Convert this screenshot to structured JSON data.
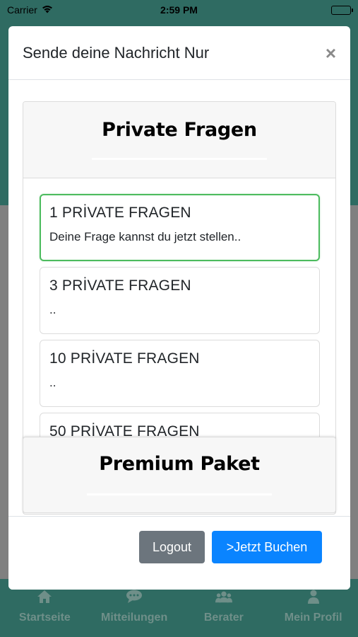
{
  "status_bar": {
    "carrier": "Carrier",
    "time": "2:59 PM"
  },
  "modal": {
    "title": "Sende deine Nachricht Nur",
    "close_symbol": "×",
    "private_section": {
      "title": "Private Fragen",
      "items": [
        {
          "title": "1 PRİVATE FRAGEN",
          "description": "Deine Frage kannst du jetzt stellen..",
          "selected": true
        },
        {
          "title": "3 PRİVATE FRAGEN",
          "description": "..",
          "selected": false
        },
        {
          "title": "10 PRİVATE FRAGEN",
          "description": "..",
          "selected": false
        },
        {
          "title": "50 PRİVATE FRAGEN",
          "description": "",
          "selected": false
        }
      ]
    },
    "premium_section": {
      "title": "Premium Paket"
    },
    "footer": {
      "logout_label": "Logout",
      "buy_label": ">Jetzt Buchen"
    }
  },
  "tabbar": {
    "tabs": [
      {
        "label": "Startseite",
        "icon": "home-icon"
      },
      {
        "label": "Mitteilungen",
        "icon": "chat-icon"
      },
      {
        "label": "Berater",
        "icon": "users-icon"
      },
      {
        "label": "Mein Profil",
        "icon": "person-icon"
      }
    ]
  },
  "colors": {
    "app_green": "#2f6b62",
    "selected_border": "#4cbb5e",
    "primary_button": "#0a84ff",
    "secondary_button": "#6c757d"
  }
}
